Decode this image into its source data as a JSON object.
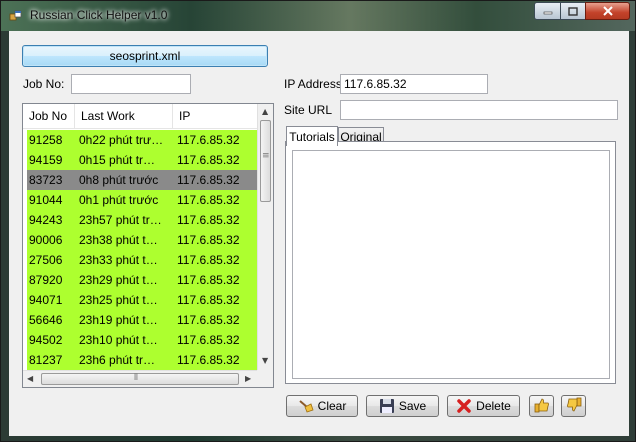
{
  "window": {
    "title": "Russian Click Helper v1.0"
  },
  "toolbar": {
    "load_button": "seosprint.xml"
  },
  "form": {
    "job_no_label": "Job No:",
    "job_no_value": "",
    "ip_label": "IP Address",
    "ip_value": "117.6.85.32",
    "url_label": "Site URL",
    "url_value": ""
  },
  "list": {
    "columns": [
      "Job No",
      "Last Work",
      "IP"
    ],
    "rows": [
      {
        "job": "91258",
        "last": "0h22 phút trư…",
        "ip": "117.6.85.32",
        "selected": false
      },
      {
        "job": "94159",
        "last": "0h15 phút tr…",
        "ip": "117.6.85.32",
        "selected": false
      },
      {
        "job": "83723",
        "last": "0h8 phút trước",
        "ip": "117.6.85.32",
        "selected": true
      },
      {
        "job": "91044",
        "last": "0h1 phút trước",
        "ip": "117.6.85.32",
        "selected": false
      },
      {
        "job": "94243",
        "last": "23h57 phút tr…",
        "ip": "117.6.85.32",
        "selected": false
      },
      {
        "job": "90006",
        "last": "23h38 phút t…",
        "ip": "117.6.85.32",
        "selected": false
      },
      {
        "job": "27506",
        "last": "23h33 phút t…",
        "ip": "117.6.85.32",
        "selected": false
      },
      {
        "job": "87920",
        "last": "23h29 phút t…",
        "ip": "117.6.85.32",
        "selected": false
      },
      {
        "job": "94071",
        "last": "23h25 phút t…",
        "ip": "117.6.85.32",
        "selected": false
      },
      {
        "job": "56646",
        "last": "23h19 phút t…",
        "ip": "117.6.85.32",
        "selected": false
      },
      {
        "job": "94502",
        "last": "23h10 phút t…",
        "ip": "117.6.85.32",
        "selected": false
      },
      {
        "job": "81237",
        "last": "23h6 phút tr…",
        "ip": "117.6.85.32",
        "selected": false
      }
    ],
    "row_color": "#adff2f",
    "selected_color": "#8a8a8a"
  },
  "tabs": [
    {
      "label": "Tutorials",
      "active": true
    },
    {
      "label": "Original",
      "active": false
    }
  ],
  "actions": {
    "clear": "Clear",
    "save": "Save",
    "delete": "Delete"
  },
  "icons": {
    "clear": "broom-icon",
    "save": "floppy-disk-icon",
    "delete": "red-x-icon",
    "like": "thumbs-up-icon",
    "dislike": "thumbs-down-icon"
  }
}
